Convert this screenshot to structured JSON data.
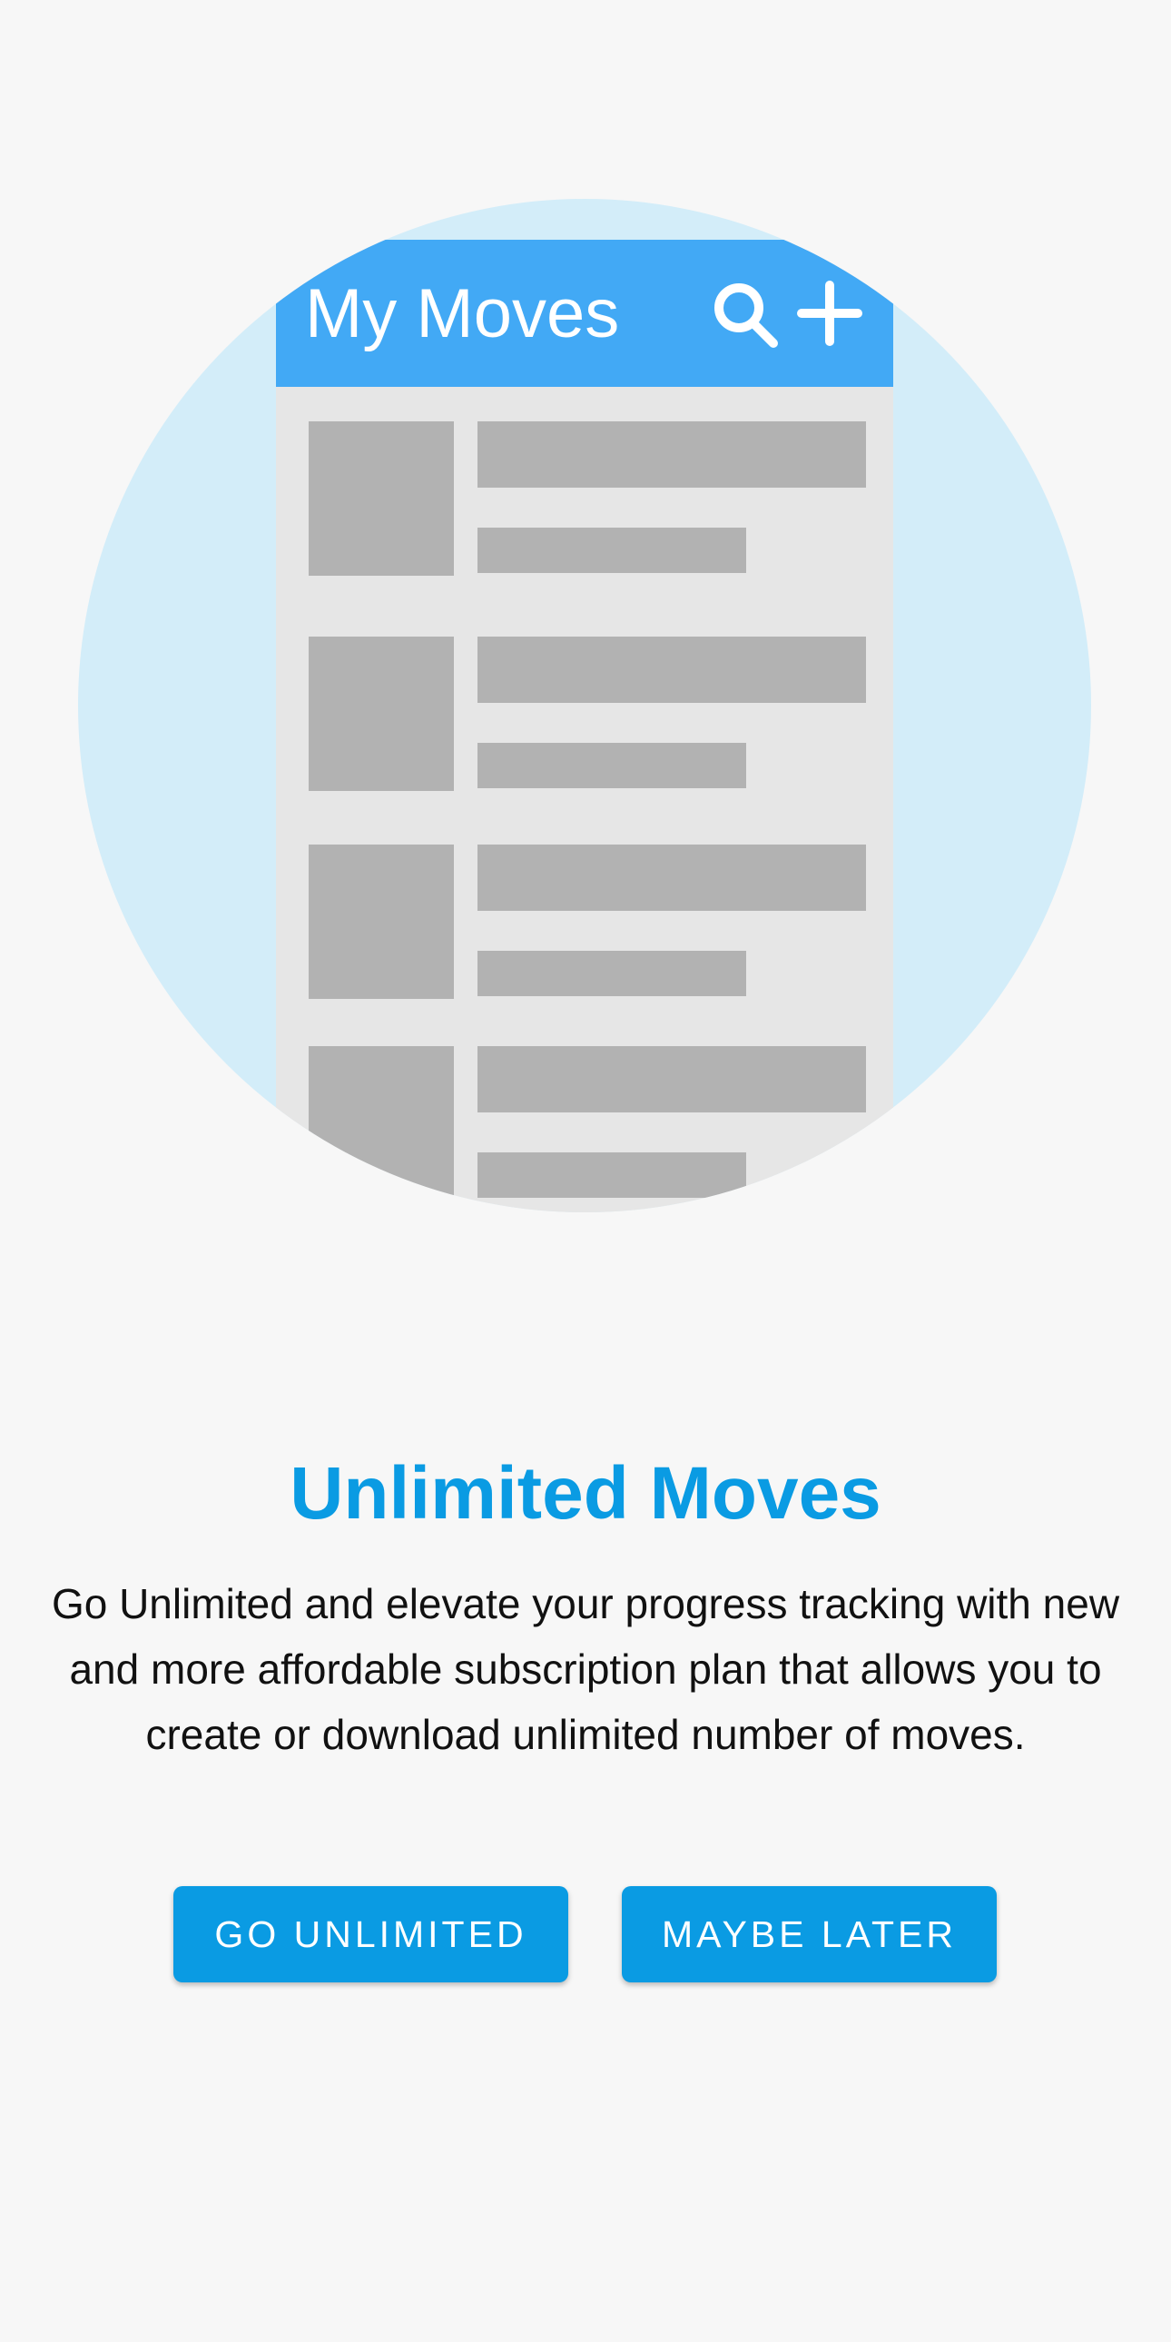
{
  "illustration": {
    "app_title": "My Moves",
    "icons": [
      "search-icon",
      "plus-icon"
    ],
    "colors": {
      "circle": "#d3edf9",
      "app_bar": "#42a9f5",
      "list_background": "#e6e6e6",
      "placeholder": "#b2b2b2"
    }
  },
  "content": {
    "title": "Unlimited Moves",
    "description": "Go Unlimited and elevate your progress tracking with new and more affordable subscription plan that allows you to create or download unlimited number of moves."
  },
  "actions": {
    "primary_label": "GO UNLIMITED",
    "secondary_label": "MAYBE LATER"
  },
  "colors": {
    "accent": "#0a9be3",
    "background": "#f7f7f7",
    "text": "#111111"
  }
}
